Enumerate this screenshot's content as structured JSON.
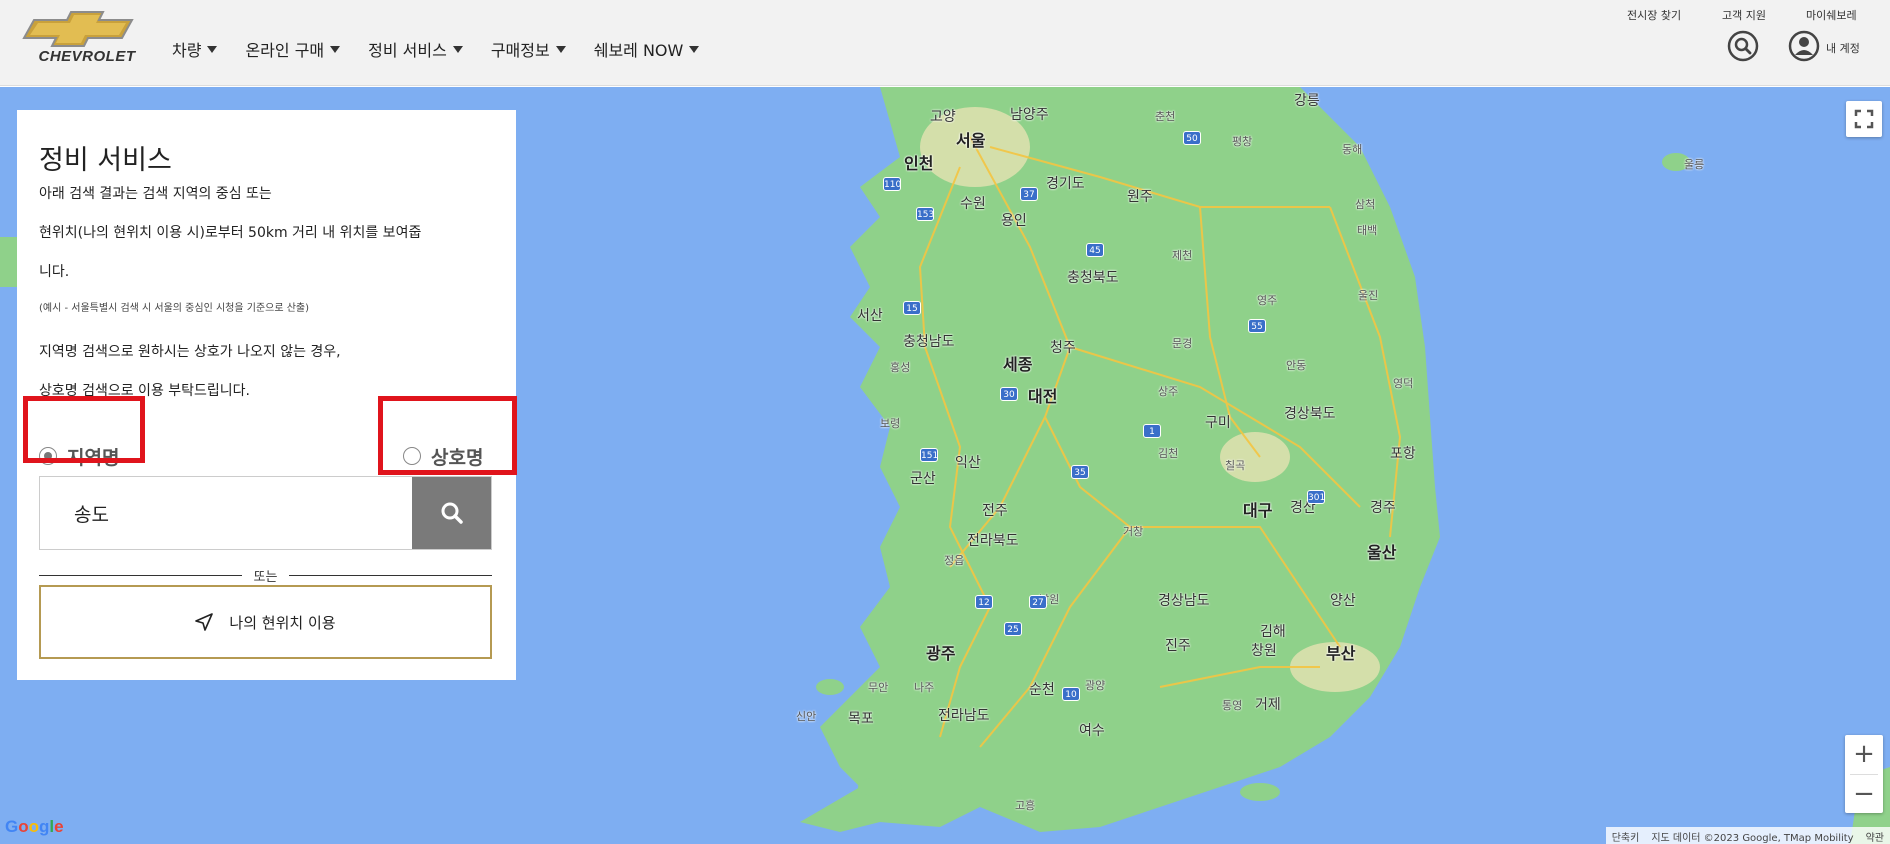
{
  "brand": {
    "name": "CHEVROLET",
    "color": "#d1a43a"
  },
  "nav": [
    {
      "label": "차량"
    },
    {
      "label": "온라인 구매"
    },
    {
      "label": "정비 서비스"
    },
    {
      "label": "구매정보"
    },
    {
      "label": "쉐보레 NOW"
    }
  ],
  "utility_links": {
    "showroom": "전시장 찾기",
    "support": "고객 지원",
    "my_chevrolet": "마이쉐보레"
  },
  "account": {
    "label": "내 계정"
  },
  "icons": {
    "search": "search-icon",
    "account": "user-circle-icon",
    "fullscreen": "fullscreen-icon",
    "location": "navigation-arrow-icon"
  },
  "panel": {
    "title": "정비 서비스",
    "desc_line1": "아래 검색 결과는 검색 지역의 중심 또는",
    "desc_line2": "현위치(나의 현위치 이용 시)로부터 50km 거리 내 위치를 보여줍",
    "desc_line3": "니다.",
    "example": "(예시 - 서울특별시 검색 시 서울의 중심인 시청을 기준으로 산출)",
    "note_line1": "지역명 검색으로 원하시는 상호가 나오지 않는 경우,",
    "note_line2": "상호명 검색으로 이용 부탁드립니다.",
    "radio_region": "지역명",
    "radio_business": "상호명",
    "selected": "region",
    "search_value": "송도",
    "or_text": "또는",
    "location_button": "나의 현위치 이용"
  },
  "colors": {
    "highlight": "#e0141c",
    "search_button": "#7a7a7a",
    "location_border": "#b59a52",
    "water": "#7eaef2",
    "land": "#8fd18a"
  },
  "map": {
    "labels": [
      {
        "text": "서울",
        "cls": "big"
      },
      {
        "text": "인천",
        "cls": "big"
      },
      {
        "text": "고양",
        "cls": ""
      },
      {
        "text": "남양주",
        "cls": ""
      },
      {
        "text": "춘천",
        "cls": "small"
      },
      {
        "text": "강릉",
        "cls": ""
      },
      {
        "text": "평창",
        "cls": "small"
      },
      {
        "text": "홍천",
        "cls": "small"
      },
      {
        "text": "동해",
        "cls": "small"
      },
      {
        "text": "수원",
        "cls": ""
      },
      {
        "text": "용인",
        "cls": ""
      },
      {
        "text": "경기도",
        "cls": ""
      },
      {
        "text": "원주",
        "cls": ""
      },
      {
        "text": "삼척",
        "cls": "small"
      },
      {
        "text": "태백",
        "cls": "small"
      },
      {
        "text": "제천",
        "cls": "small"
      },
      {
        "text": "충청북도",
        "cls": ""
      },
      {
        "text": "영주",
        "cls": "small"
      },
      {
        "text": "울진",
        "cls": "small"
      },
      {
        "text": "서산",
        "cls": ""
      },
      {
        "text": "충청남도",
        "cls": ""
      },
      {
        "text": "홍성",
        "cls": "small"
      },
      {
        "text": "세종",
        "cls": "big"
      },
      {
        "text": "청주",
        "cls": ""
      },
      {
        "text": "문경",
        "cls": "small"
      },
      {
        "text": "안동",
        "cls": "small"
      },
      {
        "text": "영덕",
        "cls": "small"
      },
      {
        "text": "보령",
        "cls": "small"
      },
      {
        "text": "대전",
        "cls": "big"
      },
      {
        "text": "상주",
        "cls": "small"
      },
      {
        "text": "구미",
        "cls": ""
      },
      {
        "text": "경상북도",
        "cls": ""
      },
      {
        "text": "포항",
        "cls": ""
      },
      {
        "text": "군산",
        "cls": ""
      },
      {
        "text": "익산",
        "cls": ""
      },
      {
        "text": "김천",
        "cls": "small"
      },
      {
        "text": "칠곡",
        "cls": "small"
      },
      {
        "text": "전주",
        "cls": ""
      },
      {
        "text": "대구",
        "cls": "big"
      },
      {
        "text": "경산",
        "cls": ""
      },
      {
        "text": "경주",
        "cls": ""
      },
      {
        "text": "전라북도",
        "cls": ""
      },
      {
        "text": "정읍",
        "cls": "small"
      },
      {
        "text": "거창",
        "cls": "small"
      },
      {
        "text": "울산",
        "cls": "big"
      },
      {
        "text": "남원",
        "cls": "small"
      },
      {
        "text": "경상남도",
        "cls": ""
      },
      {
        "text": "양산",
        "cls": ""
      },
      {
        "text": "김해",
        "cls": ""
      },
      {
        "text": "광주",
        "cls": "big"
      },
      {
        "text": "진주",
        "cls": ""
      },
      {
        "text": "창원",
        "cls": ""
      },
      {
        "text": "부산",
        "cls": "big"
      },
      {
        "text": "순천",
        "cls": ""
      },
      {
        "text": "무안",
        "cls": "small"
      },
      {
        "text": "나주",
        "cls": "small"
      },
      {
        "text": "광양",
        "cls": "small"
      },
      {
        "text": "목포",
        "cls": ""
      },
      {
        "text": "신안",
        "cls": "small"
      },
      {
        "text": "전라남도",
        "cls": ""
      },
      {
        "text": "여수",
        "cls": ""
      },
      {
        "text": "통영",
        "cls": "small"
      },
      {
        "text": "거제",
        "cls": ""
      },
      {
        "text": "고흥",
        "cls": "small"
      },
      {
        "text": "울릉",
        "cls": "small"
      }
    ],
    "shields": [
      "50",
      "37",
      "110",
      "153",
      "45",
      "15",
      "55",
      "30",
      "151",
      "35",
      "1",
      "301",
      "12",
      "27",
      "25",
      "10"
    ],
    "google": "Google",
    "attribution": [
      "단축키",
      "지도 데이터 ©2023 Google, TMap Mobility",
      "약관"
    ]
  }
}
